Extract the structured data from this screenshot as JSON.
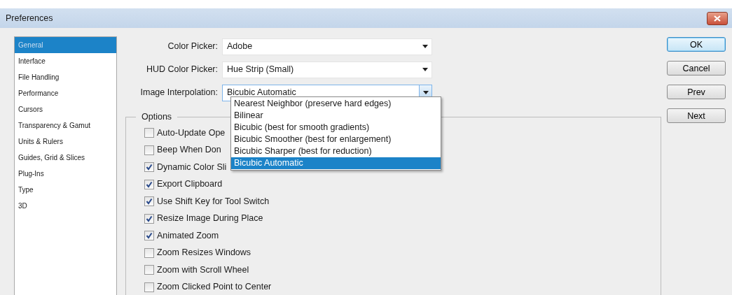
{
  "window": {
    "title": "Preferences"
  },
  "sidebar": {
    "items": [
      {
        "label": "General",
        "selected": true
      },
      {
        "label": "Interface",
        "selected": false
      },
      {
        "label": "File Handling",
        "selected": false
      },
      {
        "label": "Performance",
        "selected": false
      },
      {
        "label": "Cursors",
        "selected": false
      },
      {
        "label": "Transparency & Gamut",
        "selected": false
      },
      {
        "label": "Units & Rulers",
        "selected": false
      },
      {
        "label": "Guides, Grid & Slices",
        "selected": false
      },
      {
        "label": "Plug-Ins",
        "selected": false
      },
      {
        "label": "Type",
        "selected": false
      },
      {
        "label": "3D",
        "selected": false
      }
    ]
  },
  "fields": [
    {
      "label": "Color Picker:",
      "value": "Adobe",
      "expanded": false
    },
    {
      "label": "HUD Color Picker:",
      "value": "Hue Strip (Small)",
      "expanded": false
    },
    {
      "label": "Image Interpolation:",
      "value": "Bicubic Automatic",
      "expanded": true
    }
  ],
  "dropdown": {
    "options": [
      {
        "label": "Nearest Neighbor (preserve hard edges)",
        "selected": false
      },
      {
        "label": "Bilinear",
        "selected": false
      },
      {
        "label": "Bicubic (best for smooth gradients)",
        "selected": false
      },
      {
        "label": "Bicubic Smoother (best for enlargement)",
        "selected": false
      },
      {
        "label": "Bicubic Sharper (best for reduction)",
        "selected": false
      },
      {
        "label": "Bicubic Automatic",
        "selected": true
      }
    ]
  },
  "options": {
    "title": "Options",
    "checkboxes": [
      {
        "label": "Auto-Update Ope",
        "checked": false
      },
      {
        "label": "Beep When Don",
        "checked": false
      },
      {
        "label": "Dynamic Color Sli",
        "checked": true
      },
      {
        "label": "Export Clipboard",
        "checked": true
      },
      {
        "label": "Use Shift Key for Tool Switch",
        "checked": true
      },
      {
        "label": "Resize Image During Place",
        "checked": true
      },
      {
        "label": "Animated Zoom",
        "checked": true
      },
      {
        "label": "Zoom Resizes Windows",
        "checked": false
      },
      {
        "label": "Zoom with Scroll Wheel",
        "checked": false
      },
      {
        "label": "Zoom Clicked Point to Center",
        "checked": false
      }
    ]
  },
  "buttons": [
    {
      "label": "OK",
      "default": true
    },
    {
      "label": "Cancel",
      "default": false
    },
    {
      "label": "Prev",
      "default": false
    },
    {
      "label": "Next",
      "default": false
    }
  ]
}
